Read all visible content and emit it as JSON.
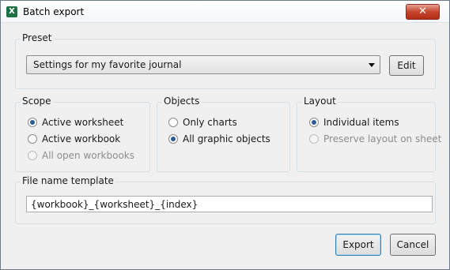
{
  "window": {
    "title": "Batch export",
    "close_symbol": "✕",
    "app_icon": "excel-icon"
  },
  "preset": {
    "label": "Preset",
    "selected": "Settings for my favorite journal",
    "edit_label": "Edit"
  },
  "scope": {
    "label": "Scope",
    "options": [
      {
        "label": "Active worksheet",
        "checked": true,
        "enabled": true
      },
      {
        "label": "Active workbook",
        "checked": false,
        "enabled": true
      },
      {
        "label": "All open workbooks",
        "checked": false,
        "enabled": false
      }
    ]
  },
  "objects": {
    "label": "Objects",
    "options": [
      {
        "label": "Only charts",
        "checked": false,
        "enabled": true
      },
      {
        "label": "All graphic objects",
        "checked": true,
        "enabled": true
      }
    ]
  },
  "layout": {
    "label": "Layout",
    "options": [
      {
        "label": "Individual items",
        "checked": true,
        "enabled": true
      },
      {
        "label": "Preserve layout on sheet",
        "checked": false,
        "enabled": false
      }
    ]
  },
  "filename": {
    "label": "File name template",
    "value": "{workbook}_{worksheet}_{index}"
  },
  "buttons": {
    "export_label": "Export",
    "cancel_label": "Cancel"
  }
}
